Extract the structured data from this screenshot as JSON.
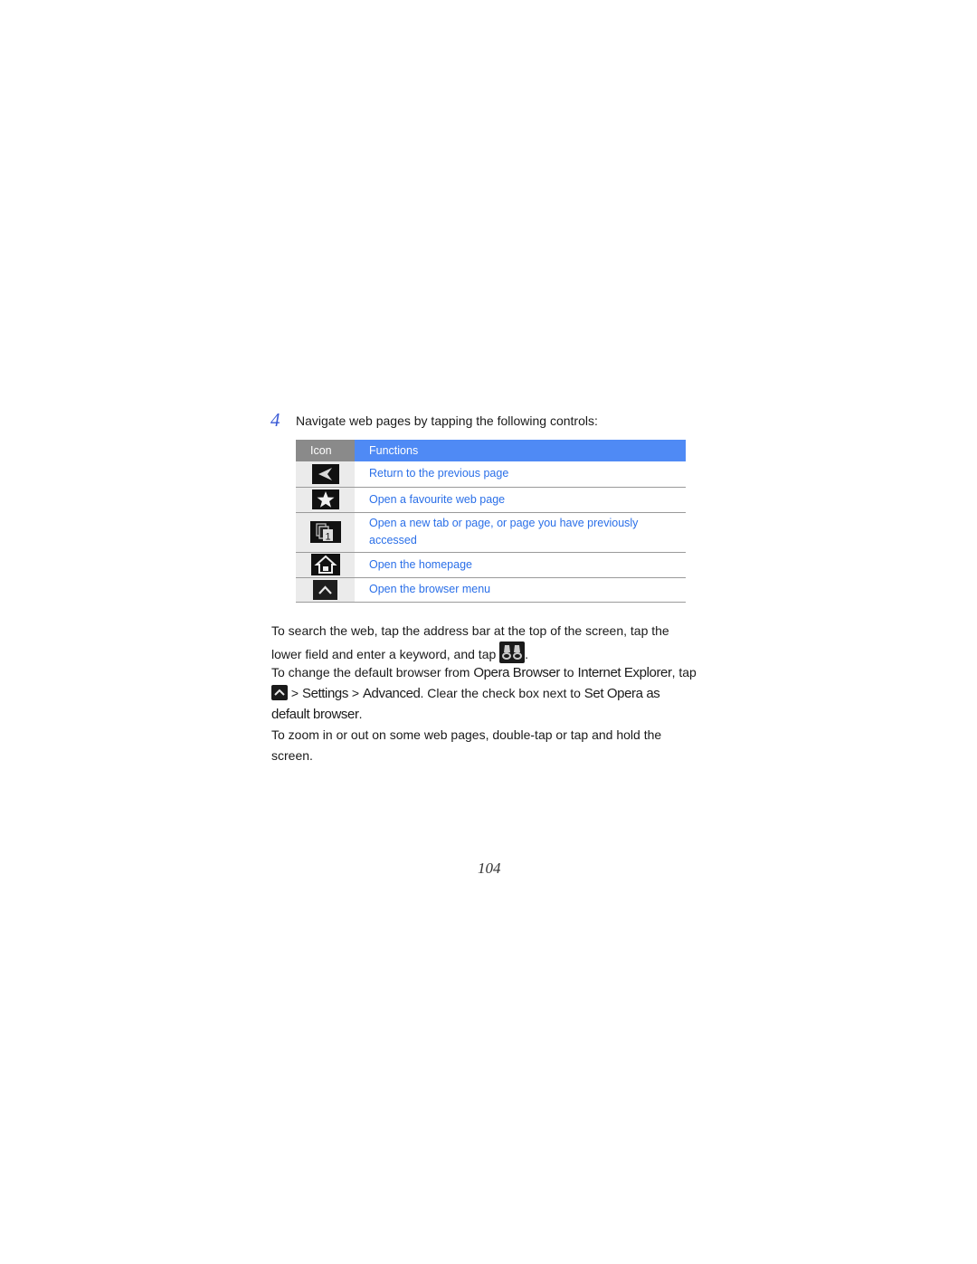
{
  "step": {
    "number": "4",
    "text": "Navigate web pages by tapping the following controls:"
  },
  "table": {
    "headers": {
      "icon": "Icon",
      "functions": "Functions"
    },
    "rows": [
      {
        "icon": "back-arrow-icon",
        "function": "Return to the previous page"
      },
      {
        "icon": "star-icon",
        "function": "Open a favourite web page"
      },
      {
        "icon": "tabs-pages-icon",
        "function": "Open a new tab or page, or page you have previously accessed"
      },
      {
        "icon": "home-icon",
        "function": "Open the homepage"
      },
      {
        "icon": "menu-up-icon",
        "function": "Open the browser menu"
      }
    ],
    "colors": {
      "header_icon_bg": "#8a8a8a",
      "header_func_bg": "#4f8af5",
      "function_text": "#2a6fe8"
    }
  },
  "paragraphs": {
    "search": {
      "before": "To search the web, tap the address bar at the top of the screen, tap the lower field and enter a keyword, and tap",
      "icon": "binoculars-search-icon",
      "after": "."
    },
    "browser": {
      "t1": "To change the default browser from ",
      "opera_browser": "Opera Browser",
      "t2": " to ",
      "internet_explorer": "Internet Explorer",
      "t3": ", tap ",
      "icon": "menu-up-icon",
      "t4": " > ",
      "settings": "Settings",
      "t5": " > ",
      "advanced": "Advanced",
      "t6": ". Clear the check box next to ",
      "set_opera": "Set Opera as default browser",
      "t7": "."
    },
    "zoom": "To zoom in or out on some web pages, double-tap or tap and hold the screen."
  },
  "page_number": "104"
}
